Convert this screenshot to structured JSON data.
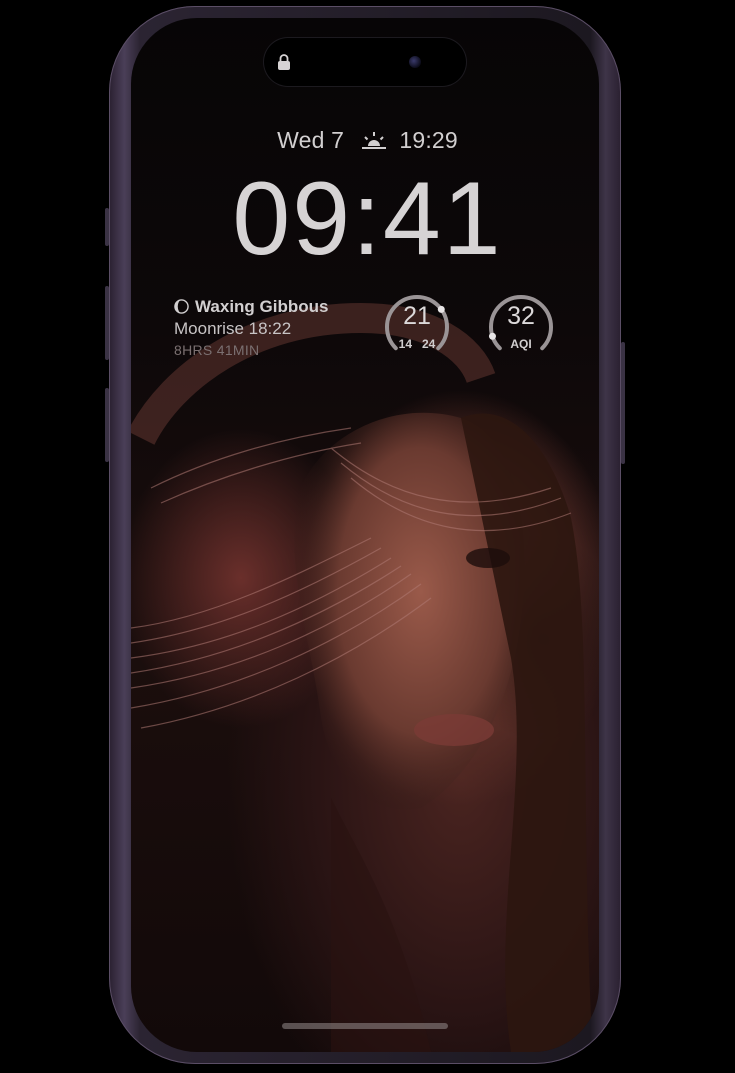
{
  "status": {
    "date": "Wed 7",
    "sun_event_icon": "sunset-icon",
    "sun_event_time": "19:29",
    "time": "09:41"
  },
  "moon_widget": {
    "icon": "moon-phase-icon",
    "title": "Waxing Gibbous",
    "moonrise": "Moonrise 18:22",
    "duration": "8HRS 41MIN"
  },
  "temp_widget": {
    "value": "21",
    "low": "14",
    "high": "24",
    "fraction": 0.7
  },
  "aqi_widget": {
    "value": "32",
    "label": "AQI",
    "fraction": 0.1
  },
  "colors": {
    "frame": "#2a2030",
    "text": "#d6d3d4",
    "screen": "#0d0809"
  }
}
